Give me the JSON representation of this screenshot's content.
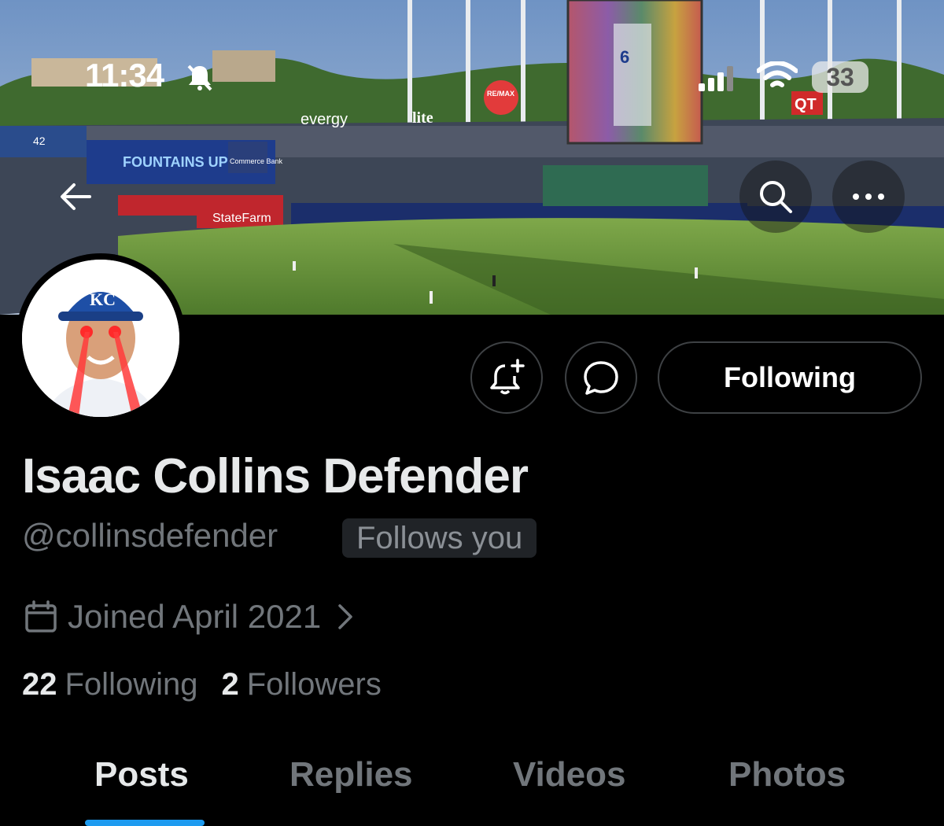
{
  "status_bar": {
    "time": "11:34",
    "battery": "33"
  },
  "banner": {
    "signs": {
      "evergy": "evergy",
      "lite": "lite",
      "remax": "RE/MAX",
      "qt": "QT",
      "fountains": "FOUNTAINS UP",
      "commerce": "Commerce Bank",
      "statefarm": "StateFarm",
      "scoreboard_number": "42",
      "player_number": "6"
    }
  },
  "profile": {
    "display_name": "Isaac Collins Defender",
    "handle": "@collinsdefender",
    "follows_you": "Follows you",
    "joined": "Joined April 2021",
    "following_count": "22",
    "following_label": "Following",
    "followers_count": "2",
    "followers_label": "Followers",
    "avatar_cap_logo": "KC"
  },
  "actions": {
    "following_button": "Following"
  },
  "tabs": [
    {
      "label": "Posts",
      "active": true
    },
    {
      "label": "Replies",
      "active": false
    },
    {
      "label": "Videos",
      "active": false
    },
    {
      "label": "Photos",
      "active": false
    }
  ],
  "colors": {
    "accent": "#1d9bf0",
    "background": "#000000",
    "muted": "#71767b"
  }
}
